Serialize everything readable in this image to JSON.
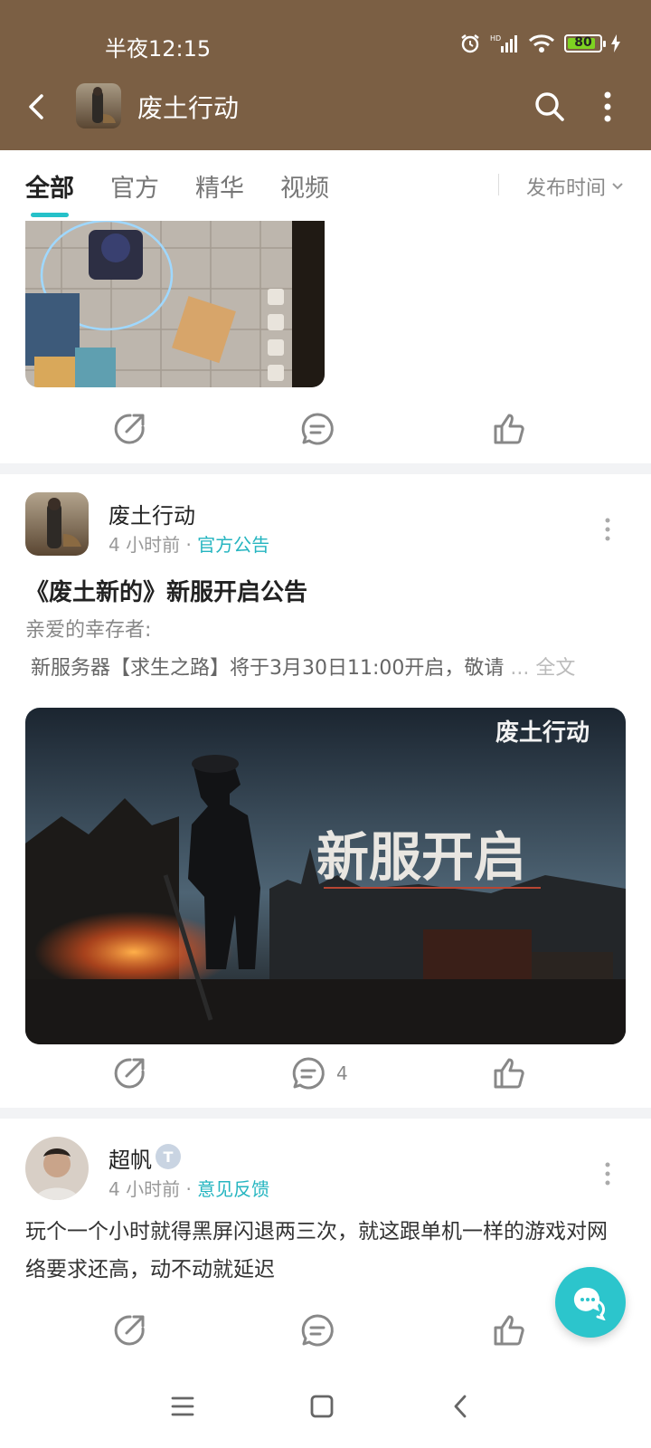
{
  "status_bar": {
    "time": "半夜12:15",
    "battery": "80"
  },
  "header": {
    "title": "废土行动"
  },
  "tabs": [
    {
      "label": "全部",
      "active": true
    },
    {
      "label": "官方",
      "active": false
    },
    {
      "label": "精华",
      "active": false
    },
    {
      "label": "视频",
      "active": false
    }
  ],
  "sort": {
    "label": "发布时间"
  },
  "posts": [
    {
      "author": "废土行动",
      "time": "4 小时前",
      "category": "官方公告",
      "title": "《废土新的》新服开启公告",
      "greeting": "亲爱的幸存者:",
      "excerpt": "新服务器【求生之路】将于3月30日11:00开启，敬请",
      "more": "... 全文",
      "banner_logo": "废土行动",
      "banner_text": "新服开启",
      "comment_count": "4"
    },
    {
      "author": "超帆",
      "badge": "T",
      "time": "4 小时前",
      "category": "意见反馈",
      "body": "玩个一个小时就得黑屏闪退两三次，就这跟单机一样的游戏对网络要求还高，动不动就延迟"
    }
  ],
  "colors": {
    "header_bg": "#7b5f44",
    "accent": "#25c1c9"
  }
}
